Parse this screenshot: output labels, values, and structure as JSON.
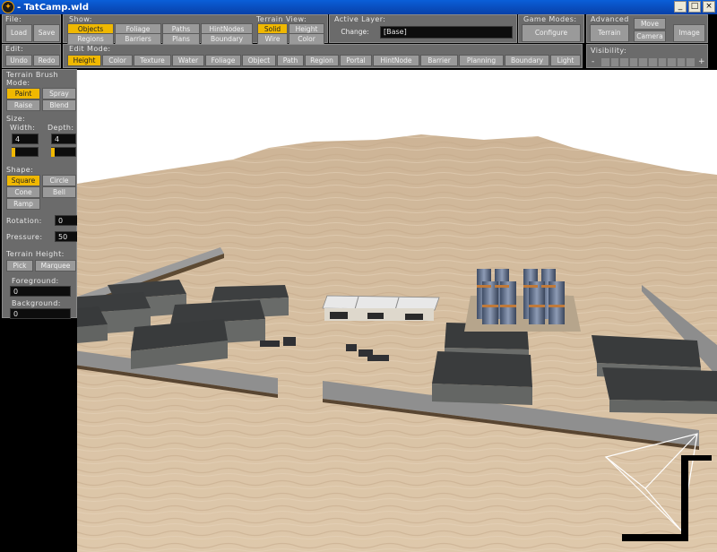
{
  "window": {
    "title": "- TatCamp.wld",
    "app_icon": "app-logo-icon"
  },
  "file": {
    "label": "File:",
    "load": "Load",
    "save": "Save"
  },
  "show": {
    "label": "Show:",
    "objects": "Objects",
    "foliage": "Foliage",
    "paths": "Paths",
    "hintnodes": "HintNodes",
    "regions": "Regions",
    "barriers": "Barriers",
    "plans": "Plans",
    "boundary": "Boundary"
  },
  "terrain_view": {
    "label": "Terrain View:",
    "solid": "Solid",
    "height": "Height",
    "wire": "Wire",
    "color": "Color"
  },
  "active_layer": {
    "label": "Active Layer:",
    "change": "Change:",
    "value": "[Base]"
  },
  "game_modes": {
    "label": "Game Modes:",
    "configure": "Configure"
  },
  "advanced": {
    "label": "Advanced",
    "terrain": "Terrain",
    "move": "Move",
    "camera": "Camera",
    "image": "Image"
  },
  "edit": {
    "label": "Edit:",
    "undo": "Undo",
    "redo": "Redo"
  },
  "edit_mode": {
    "label": "Edit Mode:",
    "items": [
      "Height",
      "Color",
      "Texture",
      "Water",
      "Foliage",
      "Object",
      "Path",
      "Region",
      "Portal",
      "HintNode",
      "Barrier",
      "Planning",
      "Boundary",
      "Light"
    ]
  },
  "visibility": {
    "label": "Visibility:",
    "minus": "-",
    "plus": "+"
  },
  "brush": {
    "title": "Terrain Brush",
    "mode_label": "Mode:",
    "paint": "Paint",
    "spray": "Spray",
    "raise": "Raise",
    "blend": "Blend",
    "size_label": "Size:",
    "width_label": "Width:",
    "depth_label": "Depth:",
    "width": "4",
    "depth": "4",
    "shape_label": "Shape:",
    "square": "Square",
    "circle": "Circle",
    "cone": "Cone",
    "bell": "Bell",
    "ramp": "Ramp",
    "rotation_label": "Rotation:",
    "rotation": "0",
    "pressure_label": "Pressure:",
    "pressure": "50",
    "terrain_height_label": "Terrain Height:",
    "pick": "Pick",
    "marquee": "Marquee",
    "foreground_label": "Foreground:",
    "foreground": "0",
    "background_label": "Background:",
    "background": "0"
  },
  "colors": {
    "accent": "#f0b800",
    "panel": "#6b6b6b",
    "sky": "#ffffff",
    "sand": "#d8bfa0"
  }
}
